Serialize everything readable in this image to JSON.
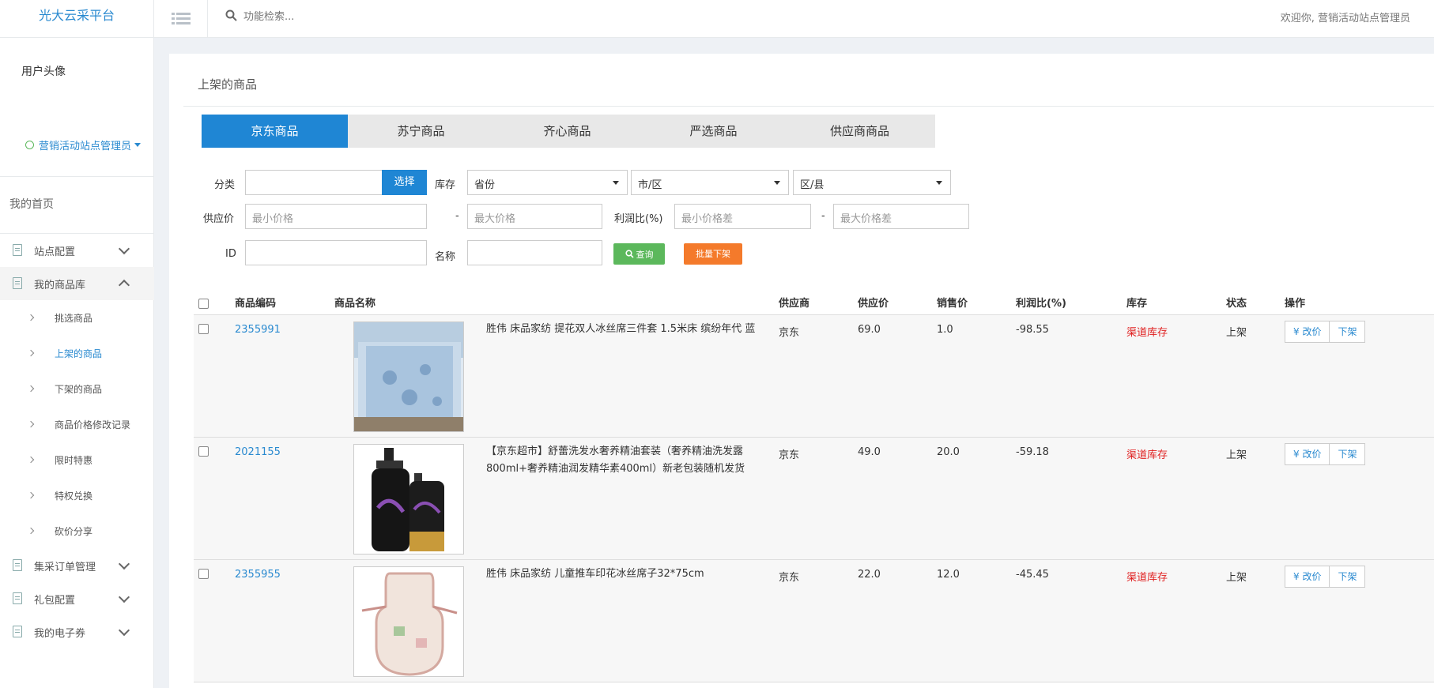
{
  "header": {
    "logo": "光大云采平台",
    "search_placeholder": "功能检索...",
    "welcome": "欢迎你, 营销活动站点管理员"
  },
  "sidebar": {
    "avatar_alt": "用户头像",
    "user_role": "营销活动站点管理员",
    "home": "我的首页",
    "groups": [
      {
        "label": "站点配置",
        "expanded": false
      },
      {
        "label": "我的商品库",
        "expanded": true
      },
      {
        "label": "集采订单管理",
        "expanded": false
      },
      {
        "label": "礼包配置",
        "expanded": false
      },
      {
        "label": "我的电子券",
        "expanded": false
      }
    ],
    "sub_items": [
      {
        "label": "挑选商品",
        "active": false
      },
      {
        "label": "上架的商品",
        "active": true
      },
      {
        "label": "下架的商品",
        "active": false
      },
      {
        "label": "商品价格修改记录",
        "active": false
      },
      {
        "label": "限时特惠",
        "active": false
      },
      {
        "label": "特权兑换",
        "active": false
      },
      {
        "label": "砍价分享",
        "active": false
      }
    ]
  },
  "main": {
    "title": "上架的商品",
    "tabs": [
      "京东商品",
      "苏宁商品",
      "齐心商品",
      "严选商品",
      "供应商商品"
    ],
    "active_tab": 0
  },
  "filters": {
    "category_label": "分类",
    "select_button": "选择",
    "stock_label": "库存",
    "province": "省份",
    "city": "市/区",
    "county": "区/县",
    "supply_price_label": "供应价",
    "min_price_placeholder": "最小价格",
    "dash": "-",
    "max_price_placeholder": "最大价格",
    "profit_label": "利润比(%)",
    "min_diff_placeholder": "最小价格差",
    "max_diff_placeholder": "最大价格差",
    "id_label": "ID",
    "name_label": "名称",
    "query_button": "查询",
    "batch_button": "批量下架"
  },
  "table": {
    "headers": [
      "商品编码",
      "商品名称",
      "供应商",
      "供应价",
      "销售价",
      "利润比(%)",
      "库存",
      "状态",
      "操作"
    ],
    "rows": [
      {
        "code": "2355991",
        "name": "胜伟 床品家纺 提花双人冰丝席三件套 1.5米床 缤纷年代 蓝",
        "supplier": "京东",
        "supply_price": "69.0",
        "sale_price": "1.0",
        "profit": "-98.55",
        "stock": "渠道库存",
        "status": "上架",
        "image": "bed-mat"
      },
      {
        "code": "2021155",
        "name": "【京东超市】舒蕾洗发水奢养精油套装（奢养精油洗发露800ml+奢养精油润发精华素400ml）新老包装随机发货",
        "supplier": "京东",
        "supply_price": "49.0",
        "sale_price": "20.0",
        "profit": "-59.18",
        "stock": "渠道库存",
        "status": "上架",
        "image": "shampoo"
      },
      {
        "code": "2355955",
        "name": "胜伟 床品家纺 儿童推车印花冰丝席子32*75cm",
        "supplier": "京东",
        "supply_price": "22.0",
        "sale_price": "12.0",
        "profit": "-45.45",
        "stock": "渠道库存",
        "status": "上架",
        "image": "stroller-mat"
      }
    ],
    "op_price": "¥ 改价",
    "op_off": "下架"
  },
  "colors": {
    "brand_blue": "#1f86d4",
    "query_green": "#5cb85c",
    "batch_orange": "#f47a2b",
    "stock_red": "#e02020"
  }
}
